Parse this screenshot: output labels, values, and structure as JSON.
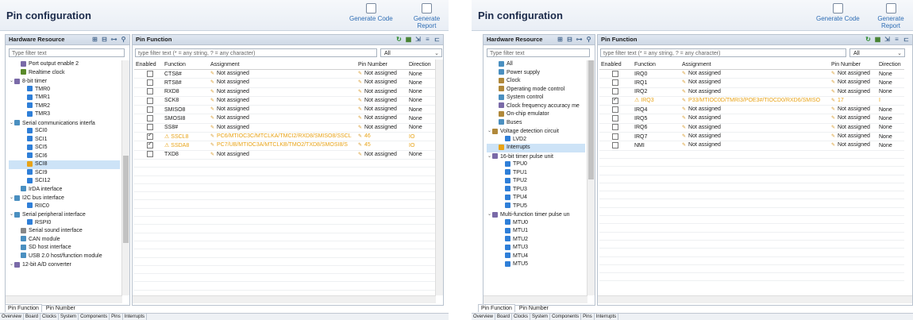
{
  "left": {
    "title": "Pin configuration",
    "generate_code": "Generate Code",
    "generate_report": "Generate Report",
    "hardware_resource": "Hardware Resource",
    "pin_function": "Pin Function",
    "hw_filter_placeholder": "Type filter text",
    "pin_filter_placeholder": "type filter text (* = any string, ? = any character)",
    "combo_value": "All",
    "tree": [
      "Port output enable 2",
      "Realtime clock",
      "8-bit timer",
      "TMR0",
      "TMR1",
      "TMR2",
      "TMR3",
      "Serial communications interfa",
      "SCI0",
      "SCI1",
      "SCI5",
      "SCI6",
      "SCI8",
      "SCI9",
      "SCI12",
      "IrDA interface",
      "I2C bus interface",
      "RIIC0",
      "Serial peripheral interface",
      "RSPI0",
      "Serial sound interface",
      "CAN module",
      "SD host interface",
      "USB 2.0 host/function module",
      "12-bit A/D converter"
    ],
    "cols": {
      "enabled": "Enabled",
      "function": "Function",
      "assignment": "Assignment",
      "pin_number": "Pin Number",
      "direction": "Direction"
    },
    "rows": [
      {
        "function": "CTS8#",
        "assignment": "Not assigned",
        "pin": "Not assigned",
        "dir": "None"
      },
      {
        "function": "RTS8#",
        "assignment": "Not assigned",
        "pin": "Not assigned",
        "dir": "None"
      },
      {
        "function": "RXD8",
        "assignment": "Not assigned",
        "pin": "Not assigned",
        "dir": "None"
      },
      {
        "function": "SCK8",
        "assignment": "Not assigned",
        "pin": "Not assigned",
        "dir": "None"
      },
      {
        "function": "SMISO8",
        "assignment": "Not assigned",
        "pin": "Not assigned",
        "dir": "None"
      },
      {
        "function": "SMOSI8",
        "assignment": "Not assigned",
        "pin": "Not assigned",
        "dir": "None"
      },
      {
        "function": "SS8#",
        "assignment": "Not assigned",
        "pin": "Not assigned",
        "dir": "None"
      },
      {
        "function": "SSCL8",
        "assignment": "PC6/MTIOC3C/MTCLKA/TMCI2/RXD8/SMISO8/SSCL",
        "pin": "46",
        "dir": "IO"
      },
      {
        "function": "SSDA8",
        "assignment": "PC7/UB/MTIOC3A/MTCLKB/TMO2/TXD8/SMOSI8/S",
        "pin": "45",
        "dir": "IO"
      },
      {
        "function": "TXD8",
        "assignment": "Not assigned",
        "pin": "Not assigned",
        "dir": "None"
      }
    ],
    "bottom_tab_function": "Pin Function",
    "bottom_tab_number": "Pin Number",
    "page_tabs": [
      "Overview",
      "Board",
      "Clocks",
      "System",
      "Components",
      "Pins",
      "Interrupts"
    ]
  },
  "right": {
    "title": "Pin configuration",
    "generate_code": "Generate Code",
    "generate_report": "Generate Report",
    "hardware_resource": "Hardware Resource",
    "pin_function": "Pin Function",
    "hw_filter_placeholder": "Type filter text",
    "pin_filter_placeholder": "type filter text (* = any string, ? = any character)",
    "combo_value": "All",
    "tree": [
      "All",
      "Power supply",
      "Clock",
      "Operating mode control",
      "System control",
      "Clock frequency accuracy me",
      "On-chip emulator",
      "Buses",
      "Voltage detection circuit",
      "LVD2",
      "Interrupts",
      "16-bit timer pulse unit",
      "TPU0",
      "TPU1",
      "TPU2",
      "TPU3",
      "TPU4",
      "TPU5",
      "Multi-function timer pulse un",
      "MTU0",
      "MTU1",
      "MTU2",
      "MTU3",
      "MTU4",
      "MTU5"
    ],
    "cols": {
      "enabled": "Enabled",
      "function": "Function",
      "assignment": "Assignment",
      "pin_number": "Pin Number",
      "direction": "Direction"
    },
    "rows": [
      {
        "function": "IRQ0",
        "assignment": "Not assigned",
        "pin": "Not assigned",
        "dir": "None"
      },
      {
        "function": "IRQ1",
        "assignment": "Not assigned",
        "pin": "Not assigned",
        "dir": "None"
      },
      {
        "function": "IRQ2",
        "assignment": "Not assigned",
        "pin": "Not assigned",
        "dir": "None"
      },
      {
        "function": "IRQ3",
        "assignment": "P33/MTIOC0D/TMRI3/POE3#/TIOCD0/RXD6/SMISO",
        "pin": "17",
        "dir": "I"
      },
      {
        "function": "IRQ4",
        "assignment": "Not assigned",
        "pin": "Not assigned",
        "dir": "None"
      },
      {
        "function": "IRQ5",
        "assignment": "Not assigned",
        "pin": "Not assigned",
        "dir": "None"
      },
      {
        "function": "IRQ6",
        "assignment": "Not assigned",
        "pin": "Not assigned",
        "dir": "None"
      },
      {
        "function": "IRQ7",
        "assignment": "Not assigned",
        "pin": "Not assigned",
        "dir": "None"
      },
      {
        "function": "NMI",
        "assignment": "Not assigned",
        "pin": "Not assigned",
        "dir": "None"
      }
    ],
    "bottom_tab_function": "Pin Function",
    "bottom_tab_number": "Pin Number",
    "page_tabs": [
      "Overview",
      "Board",
      "Clocks",
      "System",
      "Components",
      "Pins",
      "Interrupts"
    ]
  },
  "colors": {
    "accent": "#2e6db4",
    "warning": "#e8a317",
    "selection": "#cde3f7",
    "header": "#dfe7f1"
  }
}
